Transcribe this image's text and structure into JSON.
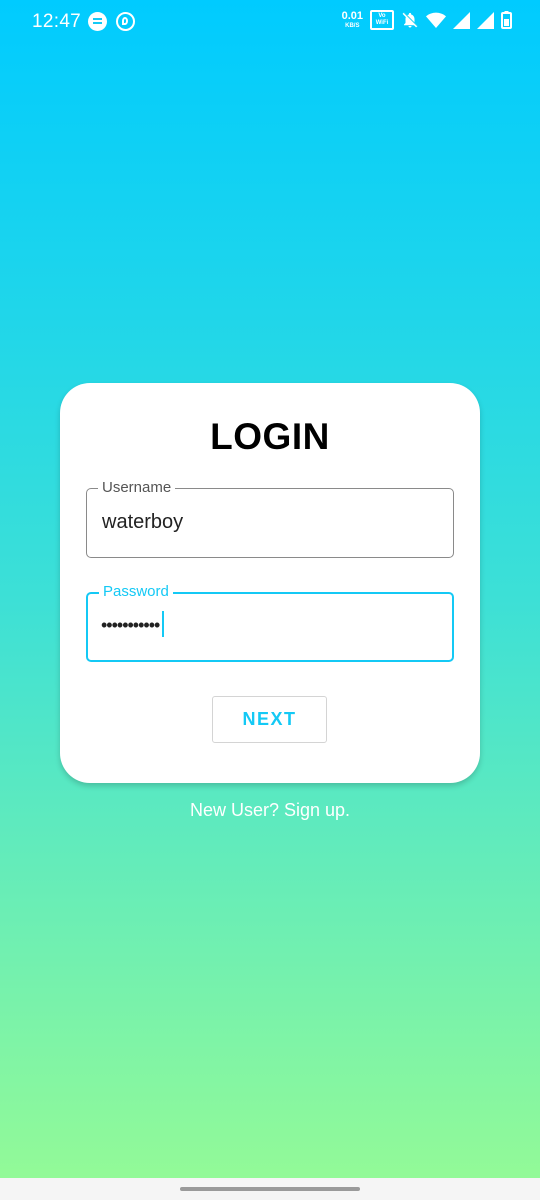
{
  "status_bar": {
    "time": "12:47",
    "net_speed_value": "0.01",
    "net_speed_unit": "KB/S",
    "vowifi_top": "Vo",
    "vowifi_bottom": "WiFi",
    "icons": [
      "chat-bubble-icon",
      "sync-ring-icon",
      "bell-off-icon",
      "wifi-icon",
      "signal-icon",
      "signal-icon",
      "battery-icon"
    ]
  },
  "login": {
    "title": "LOGIN",
    "username": {
      "label": "Username",
      "value": "waterboy"
    },
    "password": {
      "label": "Password",
      "value": "•••••••••••"
    },
    "next_label": "NEXT"
  },
  "signup_link": "New User? Sign up.",
  "colors": {
    "gradient_top": "#00cbff",
    "gradient_bottom": "#96fb95",
    "accent": "#14c9f5"
  }
}
